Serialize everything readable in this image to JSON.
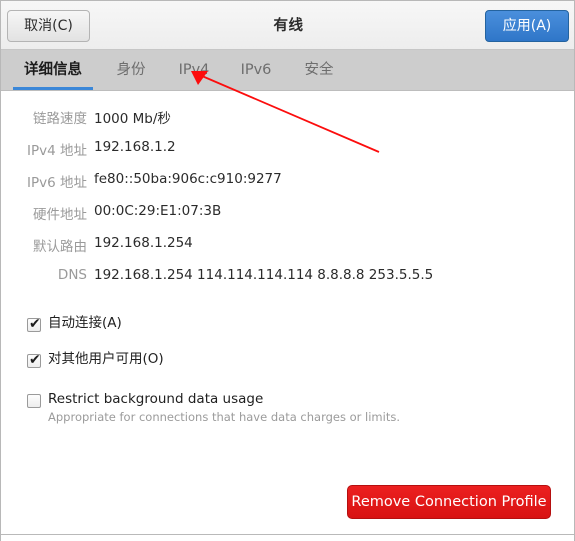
{
  "header": {
    "title": "有线",
    "cancel_label": "取消(C)",
    "apply_label": "应用(A)"
  },
  "tabs": [
    {
      "label": "详细信息",
      "active": true
    },
    {
      "label": "身份",
      "active": false
    },
    {
      "label": "IPv4",
      "active": false
    },
    {
      "label": "IPv6",
      "active": false
    },
    {
      "label": "安全",
      "active": false
    }
  ],
  "details": [
    {
      "label": "链路速度",
      "value": "1000 Mb/秒"
    },
    {
      "label": "IPv4 地址",
      "value": "192.168.1.2"
    },
    {
      "label": "IPv6 地址",
      "value": "fe80::50ba:906c:c910:9277"
    },
    {
      "label": "硬件地址",
      "value": "00:0C:29:E1:07:3B"
    },
    {
      "label": "默认路由",
      "value": "192.168.1.254"
    },
    {
      "label": "DNS",
      "value": "192.168.1.254 114.114.114.114 8.8.8.8 253.5.5.5"
    }
  ],
  "options": [
    {
      "label": "自动连接(A)",
      "checked": true,
      "tick": "✔",
      "sublabel": ""
    },
    {
      "label": "对其他用户可用(O)",
      "checked": true,
      "tick": "✔",
      "sublabel": ""
    },
    {
      "label": "Restrict background data usage",
      "checked": false,
      "tick": "✔",
      "sublabel": "Appropriate for connections that have data charges or limits."
    }
  ],
  "remove_button": {
    "label": "Remove Connection Profile"
  },
  "annotation": {
    "arrow_color": "#fc0d0d",
    "points_to": "IPv4"
  },
  "colors": {
    "accent_blue": "#3b87d8",
    "danger_red": "#d81212",
    "tabbar_gray": "#cdcdcd"
  }
}
